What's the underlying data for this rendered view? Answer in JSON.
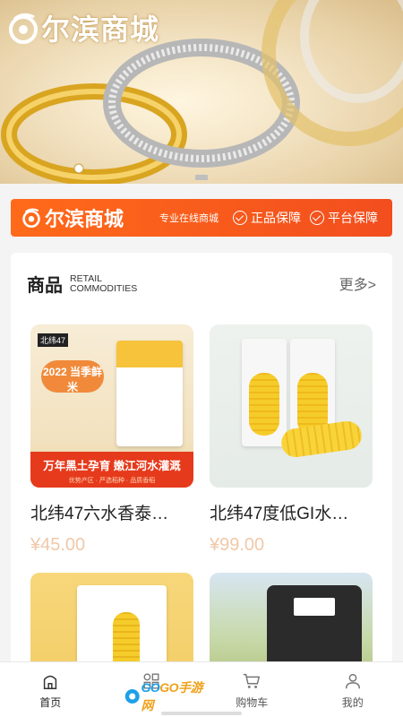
{
  "banner": {
    "logo_text": "尔滨商城"
  },
  "promo": {
    "logo_text": "尔滨商城",
    "tagline": "专业在线商城",
    "badges": [
      "正品保障",
      "平台保障"
    ]
  },
  "section": {
    "title": "商品",
    "subtitle_en_1": "RETAIL",
    "subtitle_en_2": "COMMODITIES",
    "more": "更多>"
  },
  "products": [
    {
      "name": "北纬47六水香泰…",
      "price": "¥45.00",
      "image": {
        "brand": "北纬47",
        "tag": "2022 当季鲜米",
        "strip": "万年黑土孕育  嫩江河水灌溉",
        "strip_small": "优势产区 · 严选稻种 · 品质香稻"
      }
    },
    {
      "name": "北纬47度低GI水…",
      "price": "¥99.00"
    },
    {
      "name": "",
      "price": ""
    },
    {
      "name": "",
      "price": ""
    }
  ],
  "tabbar": [
    {
      "label": "首页",
      "icon": "home-icon",
      "active": true
    },
    {
      "label": "",
      "icon": "category-icon",
      "active": false
    },
    {
      "label": "购物车",
      "icon": "cart-icon",
      "active": false
    },
    {
      "label": "我的",
      "icon": "user-icon",
      "active": false
    }
  ],
  "watermark": {
    "text_a": "GO",
    "text_b": "GO手游网"
  }
}
